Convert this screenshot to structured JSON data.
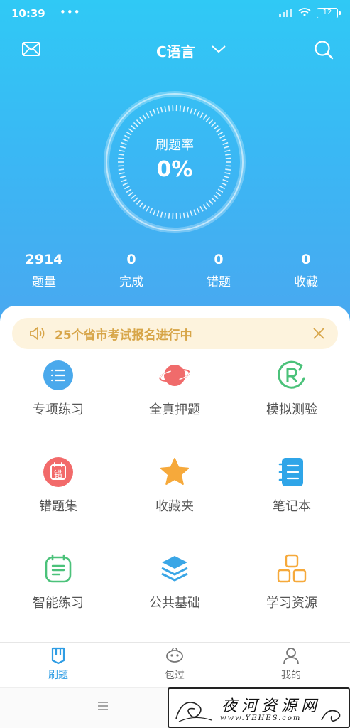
{
  "status_bar": {
    "time": "10:39",
    "dots": "•••",
    "battery": "12"
  },
  "header": {
    "title": "C语言",
    "mail_icon": "mail-icon",
    "dropdown_icon": "chevron-down-icon",
    "search_icon": "search-icon"
  },
  "progress": {
    "label": "刷题率",
    "value": "0%"
  },
  "stats": [
    {
      "value": "2914",
      "label": "题量"
    },
    {
      "value": "0",
      "label": "完成"
    },
    {
      "value": "0",
      "label": "错题"
    },
    {
      "value": "0",
      "label": "收藏"
    }
  ],
  "notice": {
    "text": "25个省市考试报名进行中",
    "icon": "speaker-icon",
    "close_icon": "close-icon"
  },
  "grid": [
    {
      "label": "专项练习",
      "icon": "list-icon"
    },
    {
      "label": "全真押题",
      "icon": "planet-icon"
    },
    {
      "label": "模拟测验",
      "icon": "r-refresh-icon"
    },
    {
      "label": "错题集",
      "icon": "calendar-mistake-icon",
      "badge": "错"
    },
    {
      "label": "收藏夹",
      "icon": "star-icon"
    },
    {
      "label": "笔记本",
      "icon": "notebook-icon"
    },
    {
      "label": "智能练习",
      "icon": "note-icon"
    },
    {
      "label": "公共基础",
      "icon": "layers-icon"
    },
    {
      "label": "学习资源",
      "icon": "grid-squares-icon"
    }
  ],
  "tabs": [
    {
      "label": "刷题",
      "icon": "book-icon",
      "active": true
    },
    {
      "label": "包过",
      "icon": "mascot-icon",
      "active": false
    },
    {
      "label": "我的",
      "icon": "person-icon",
      "active": false
    }
  ],
  "watermark": {
    "title": "夜河资源网",
    "url": "www.YEHES.com"
  },
  "colors": {
    "hero_top": "#30c9f5",
    "hero_bottom": "#4aa7f0",
    "notice_bg": "#fdf3dd",
    "notice_text": "#d7a548",
    "tab_active": "#2f9de4"
  }
}
